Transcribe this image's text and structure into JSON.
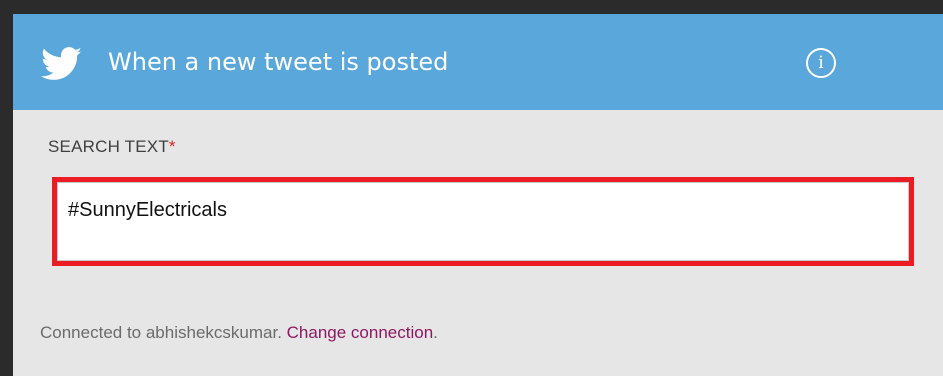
{
  "header": {
    "icon": "twitter-bird-icon",
    "title": "When a new tweet is posted",
    "info_icon": "info-icon",
    "info_glyph": "i",
    "background_color": "#5aa7db"
  },
  "field": {
    "label": "SEARCH TEXT",
    "required_marker": "*",
    "value": "#SunnyElectricals",
    "highlight_color": "#ed1c24"
  },
  "footer": {
    "prefix": "Connected to abhishekcskumar. ",
    "link_label": "Change connection",
    "suffix": ".",
    "link_color": "#8e1862"
  }
}
